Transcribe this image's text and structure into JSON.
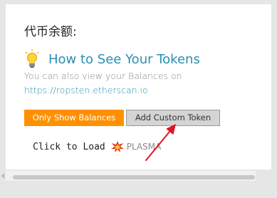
{
  "balances": {
    "title": "代币余额:",
    "howto_link": "How to See Your Tokens",
    "hint": "You can also view your Balances on",
    "etherscan_link": "https://ropsten.etherscan.io",
    "only_show_balances_label": "Only Show Balances",
    "add_custom_token_label": "Add Custom Token",
    "click_to_load_label": "Click to Load",
    "plasma_label": "PLASMA"
  },
  "icons": {
    "bulb": "lightbulb-icon",
    "collision": "collision-icon",
    "annotation": "red-arrow-annotation"
  },
  "colors": {
    "accent_orange": "#ff9000",
    "link_blue": "#2a8fb0",
    "annotation_red": "#e0141e",
    "secondary_button": "#d4d4d4"
  }
}
